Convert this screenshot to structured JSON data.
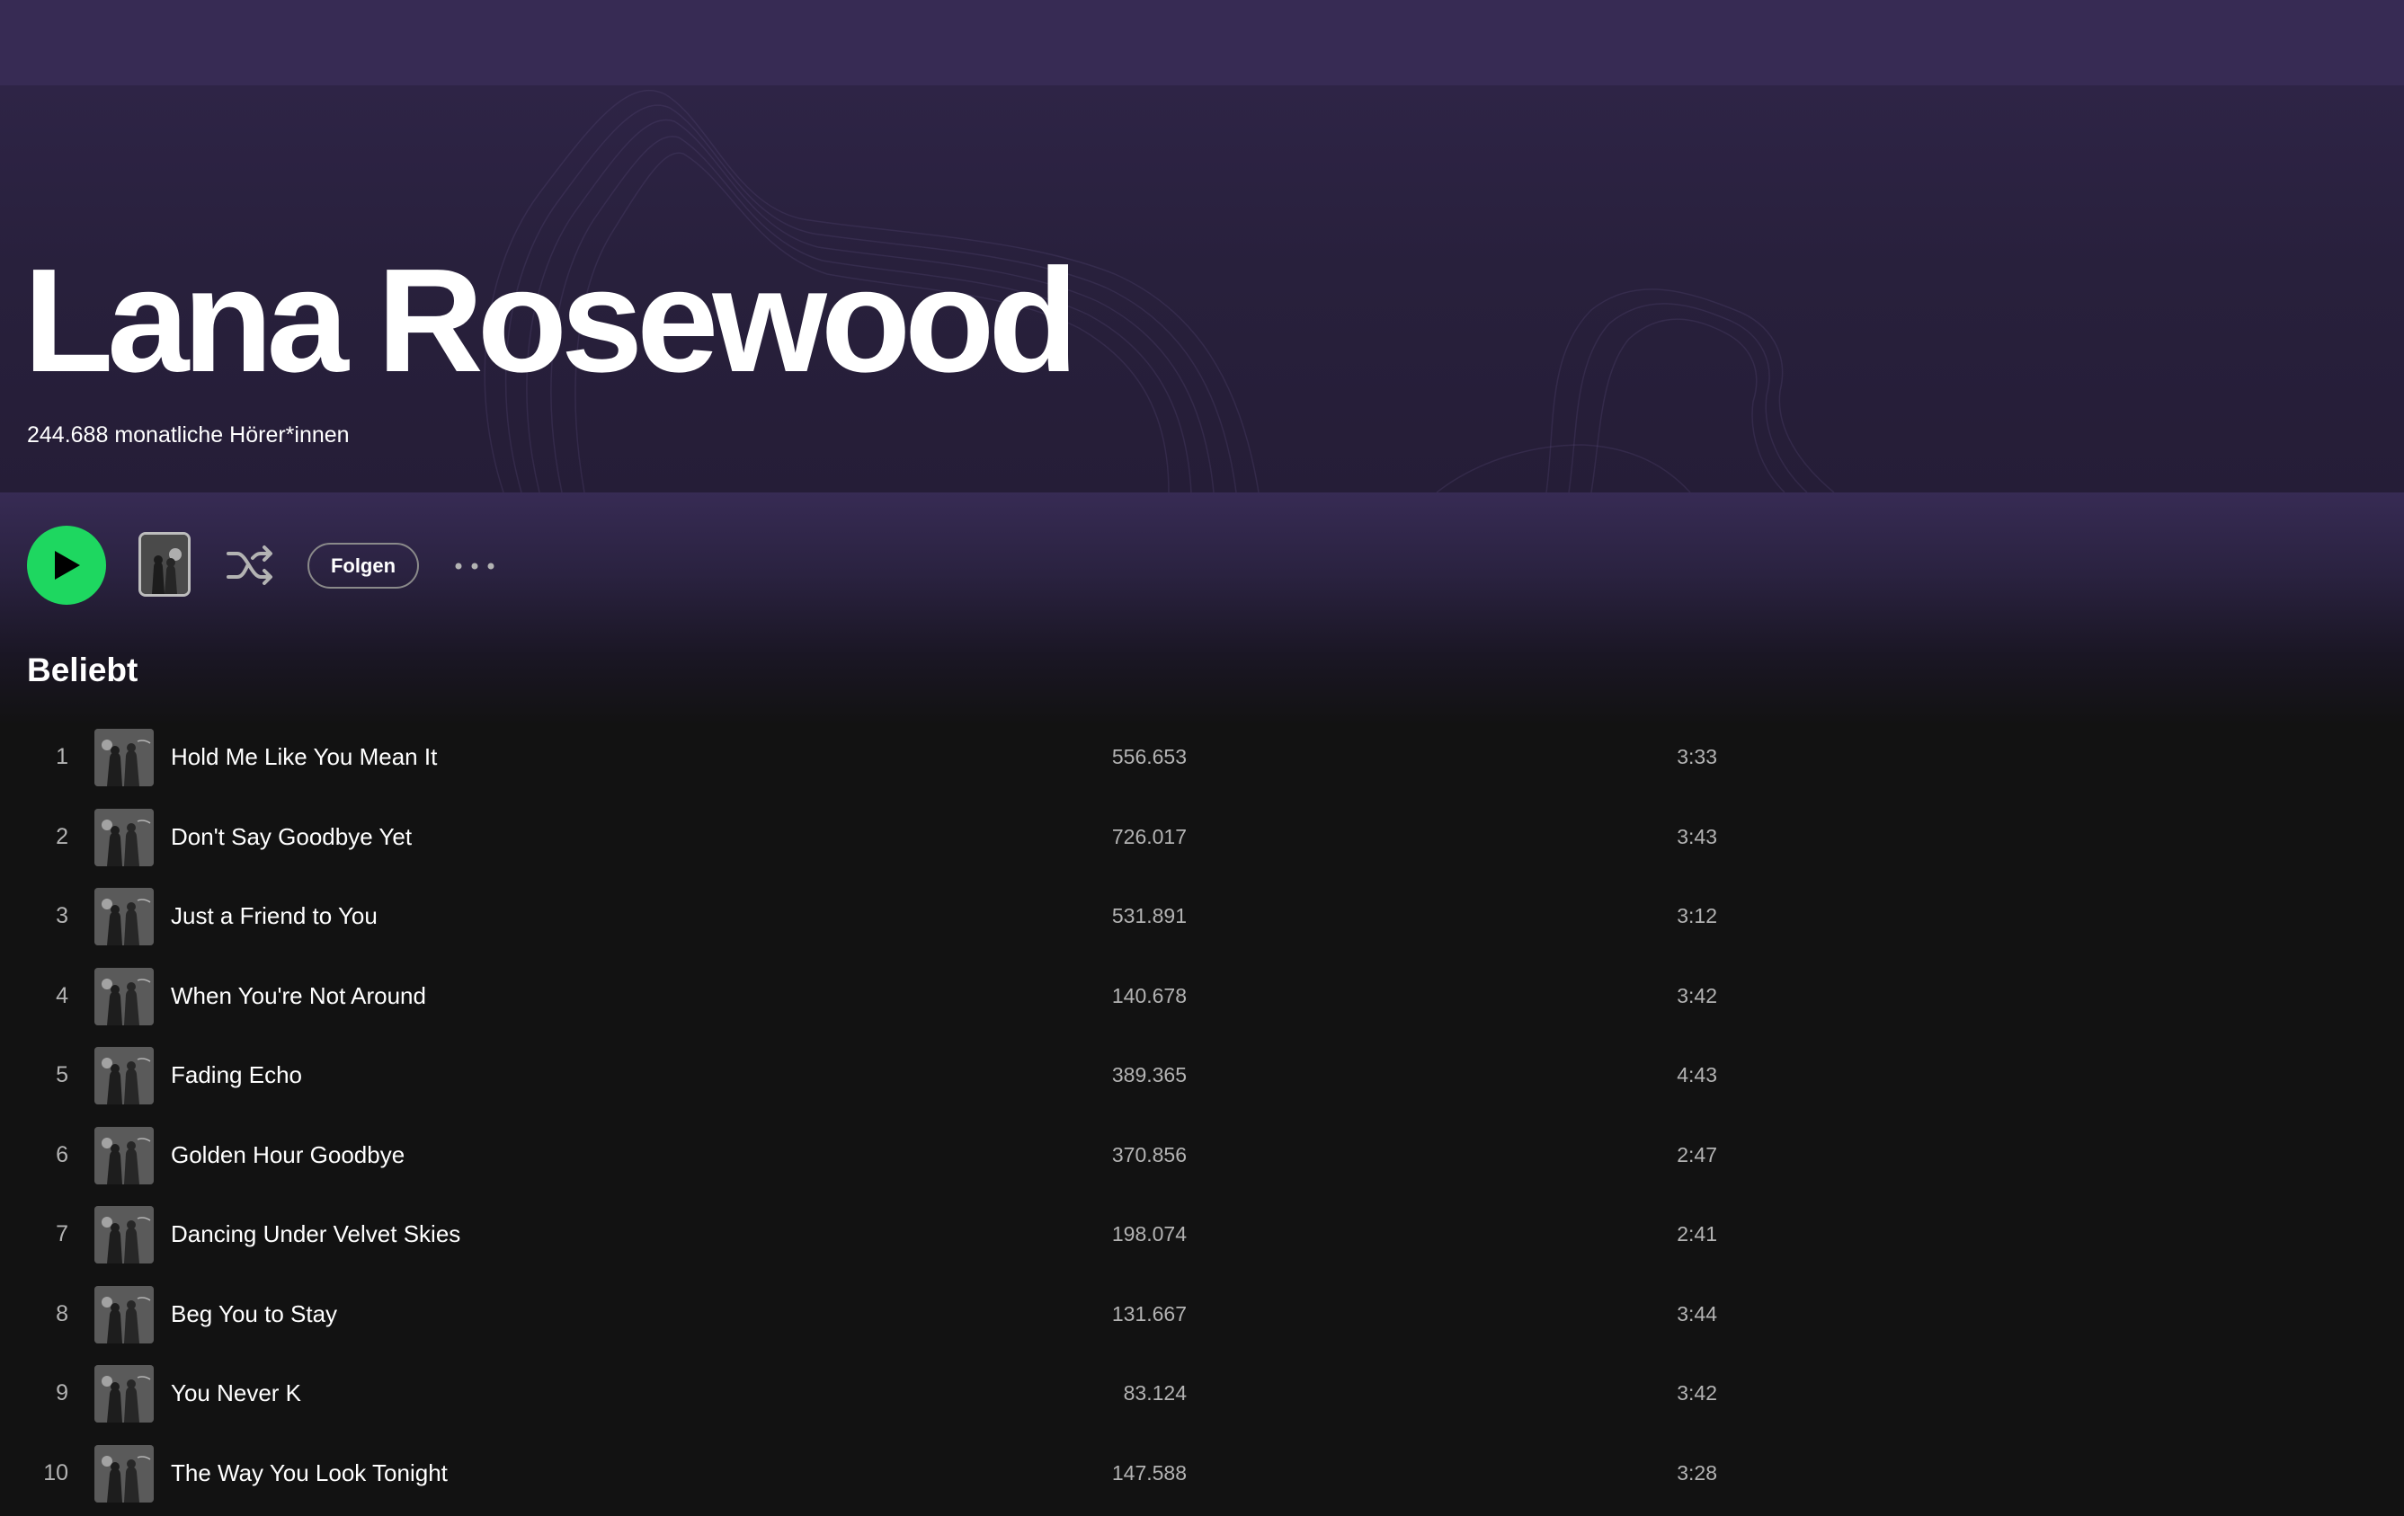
{
  "artist": {
    "name": "Lana Rosewood",
    "monthly_listeners": "244.688 monatliche Hörer*innen"
  },
  "actions": {
    "play_icon": "play-icon",
    "shuffle_icon": "shuffle-icon",
    "follow_label": "Folgen",
    "more_icon": "more-horizontal-icon"
  },
  "popular": {
    "title": "Beliebt",
    "tracks": [
      {
        "number": "1",
        "title": "Hold Me Like You Mean It",
        "plays": "556.653",
        "duration": "3:33"
      },
      {
        "number": "2",
        "title": "Don't Say Goodbye Yet",
        "plays": "726.017",
        "duration": "3:43"
      },
      {
        "number": "3",
        "title": "Just a Friend to You",
        "plays": "531.891",
        "duration": "3:12"
      },
      {
        "number": "4",
        "title": "When You're Not Around",
        "plays": "140.678",
        "duration": "3:42"
      },
      {
        "number": "5",
        "title": "Fading Echo",
        "plays": "389.365",
        "duration": "4:43"
      },
      {
        "number": "6",
        "title": "Golden Hour Goodbye",
        "plays": "370.856",
        "duration": "2:47"
      },
      {
        "number": "7",
        "title": "Dancing Under Velvet Skies",
        "plays": "198.074",
        "duration": "2:41"
      },
      {
        "number": "8",
        "title": "Beg You to Stay",
        "plays": "131.667",
        "duration": "3:44"
      },
      {
        "number": "9",
        "title": "You Never K",
        "plays": "83.124",
        "duration": "3:42"
      },
      {
        "number": "10",
        "title": "The Way You Look Tonight",
        "plays": "147.588",
        "duration": "3:28"
      }
    ]
  },
  "colors": {
    "accent_green": "#1ed760",
    "hero_purple": "#372b54",
    "background": "#121212",
    "secondary_text": "#b3b3b3"
  }
}
